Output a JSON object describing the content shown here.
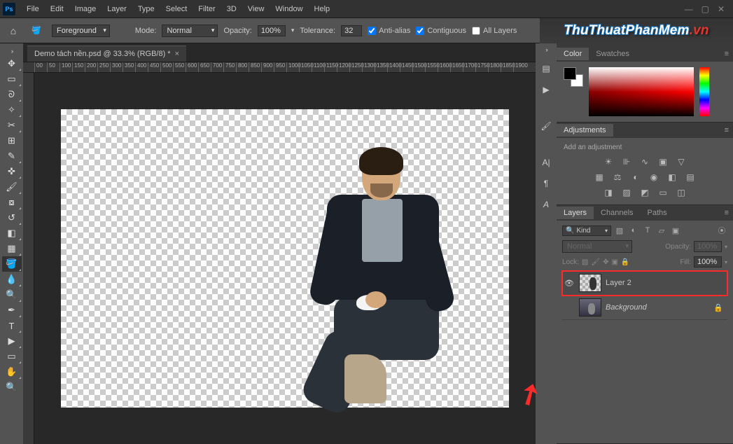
{
  "menu": [
    "File",
    "Edit",
    "Image",
    "Layer",
    "Type",
    "Select",
    "Filter",
    "3D",
    "View",
    "Window",
    "Help"
  ],
  "options": {
    "foreground_label": "Foreground",
    "mode_label": "Mode:",
    "mode_value": "Normal",
    "opacity_label": "Opacity:",
    "opacity_value": "100%",
    "tolerance_label": "Tolerance:",
    "tolerance_value": "32",
    "antialias": "Anti-alias",
    "contiguous": "Contiguous",
    "all_layers": "All Layers"
  },
  "document": {
    "tab_title": "Demo tách nền.psd @ 33.3% (RGB/8) *"
  },
  "ruler_ticks": [
    "00",
    "50",
    "100",
    "150",
    "200",
    "250",
    "300",
    "350",
    "400",
    "450",
    "500",
    "550",
    "600",
    "650",
    "700",
    "750",
    "800",
    "850",
    "900",
    "950",
    "1000",
    "1050",
    "1100",
    "1150",
    "1200",
    "1250",
    "1300",
    "1350",
    "1400",
    "1450",
    "1500",
    "1550",
    "1600",
    "1650",
    "1700",
    "1750",
    "1800",
    "1850",
    "1900"
  ],
  "panels": {
    "color": {
      "tab1": "Color",
      "tab2": "Swatches"
    },
    "adjustments": {
      "tab": "Adjustments",
      "hint": "Add an adjustment"
    },
    "layers": {
      "tab1": "Layers",
      "tab2": "Channels",
      "tab3": "Paths",
      "kind_label": "Kind",
      "blend_mode": "Normal",
      "opacity_label": "Opacity:",
      "opacity_value": "100%",
      "lock_label": "Lock:",
      "fill_label": "Fill:",
      "fill_value": "100%",
      "items": [
        {
          "name": "Layer 2",
          "visible": true,
          "selected": true,
          "locked": false,
          "italic": false
        },
        {
          "name": "Background",
          "visible": false,
          "selected": false,
          "locked": true,
          "italic": true
        }
      ]
    }
  },
  "watermark": {
    "main": "ThuThuatPhanMem",
    "suffix": ".vn"
  },
  "tools": [
    "move-tool",
    "marquee-tool",
    "lasso-tool",
    "magic-wand-tool",
    "crop-tool",
    "frame-tool",
    "eyedropper-tool",
    "healing-brush-tool",
    "brush-tool",
    "clone-stamp-tool",
    "history-brush-tool",
    "eraser-tool",
    "gradient-tool",
    "paint-bucket-tool",
    "blur-tool",
    "dodge-tool",
    "pen-tool",
    "type-tool",
    "path-selection-tool",
    "rectangle-tool",
    "hand-tool",
    "zoom-tool"
  ],
  "panel_strip_icons": [
    "history-icon",
    "play-icon",
    "brush-settings-icon",
    "character-icon",
    "paragraph-icon",
    "glyphs-icon"
  ]
}
